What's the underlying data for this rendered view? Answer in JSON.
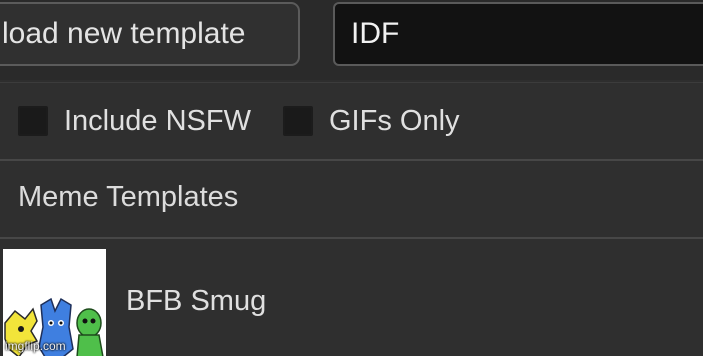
{
  "toolbar": {
    "upload_label": "load new template",
    "search_value": "IDF"
  },
  "filters": {
    "nsfw_label": "Include NSFW",
    "nsfw_checked": false,
    "gifs_label": "GIFs Only",
    "gifs_checked": false
  },
  "section": {
    "title": "Meme Templates"
  },
  "templates": [
    {
      "name": "BFB Smug"
    }
  ],
  "watermark": "imgflip.com",
  "colors": {
    "background": "#2e2e2e",
    "input_background": "#121212",
    "divider": "#474747",
    "text": "#e0e0e0",
    "thumb_yellow": "#f2e43a",
    "thumb_blue": "#3f7fe0",
    "thumb_green": "#4fbf4a"
  }
}
